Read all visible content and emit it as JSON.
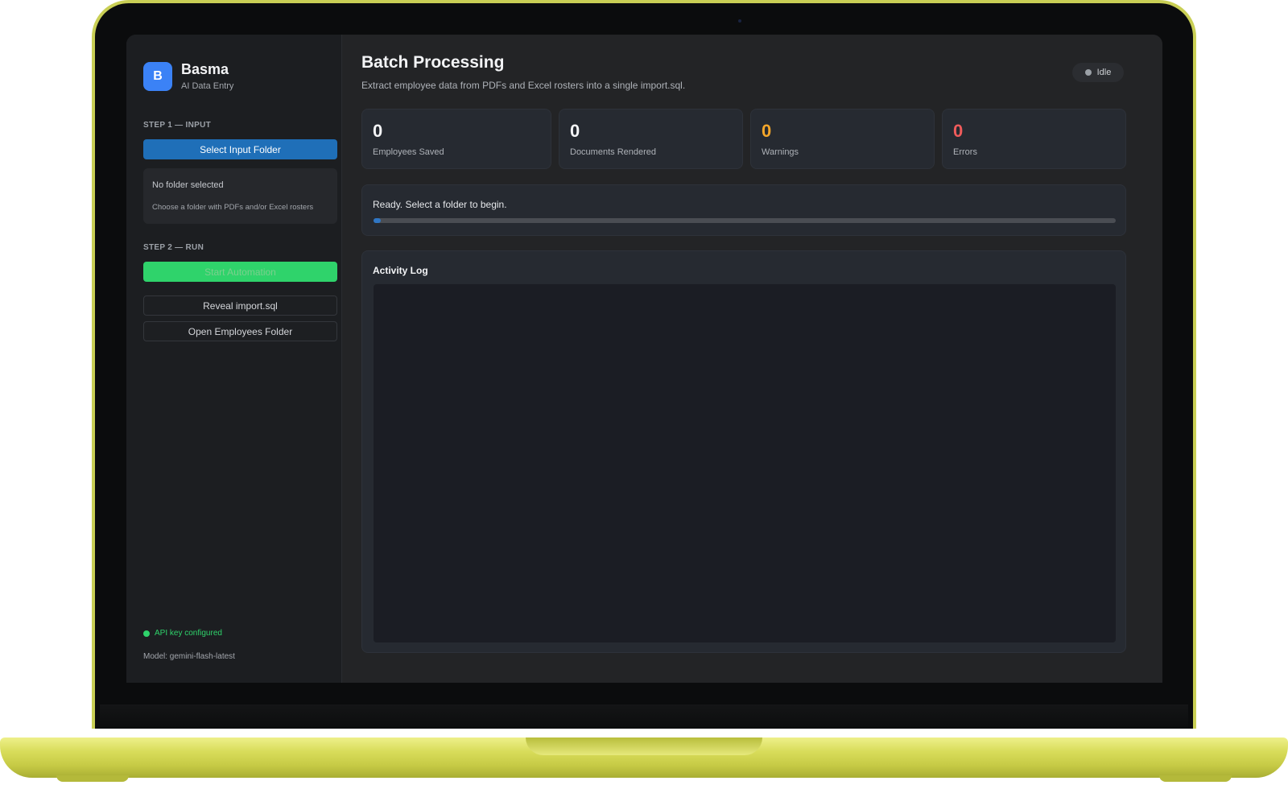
{
  "app": {
    "name": "Basma",
    "logo_letter": "B",
    "subtitle": "AI Data Entry"
  },
  "sidebar": {
    "step1_label": "STEP 1 — INPUT",
    "select_folder_button": "Select Input Folder",
    "folder_status": "No folder selected",
    "folder_hint": "Choose a folder with PDFs and/or Excel rosters",
    "step2_label": "STEP 2 — RUN",
    "start_button": "Start Automation",
    "reveal_button": "Reveal import.sql",
    "open_folder_button": "Open Employees Folder",
    "api_status": "API key configured",
    "model": "Model: gemini-flash-latest"
  },
  "main": {
    "title": "Batch Processing",
    "subtitle": "Extract employee data from PDFs and Excel rosters into a single import.sql.",
    "status": "Idle",
    "stats": [
      {
        "value": "0",
        "label": "Employees Saved"
      },
      {
        "value": "0",
        "label": "Documents Rendered"
      },
      {
        "value": "0",
        "label": "Warnings"
      },
      {
        "value": "0",
        "label": "Errors"
      }
    ],
    "progress_text": "Ready. Select a folder to begin.",
    "progress_fraction": 0.01,
    "log_title": "Activity Log"
  },
  "colors": {
    "accent_blue": "#1f6fb8",
    "run_green": "#2fd36b",
    "warning": "#f4a62a",
    "error": "#ef5b5b",
    "frame": "#c9cf55"
  }
}
